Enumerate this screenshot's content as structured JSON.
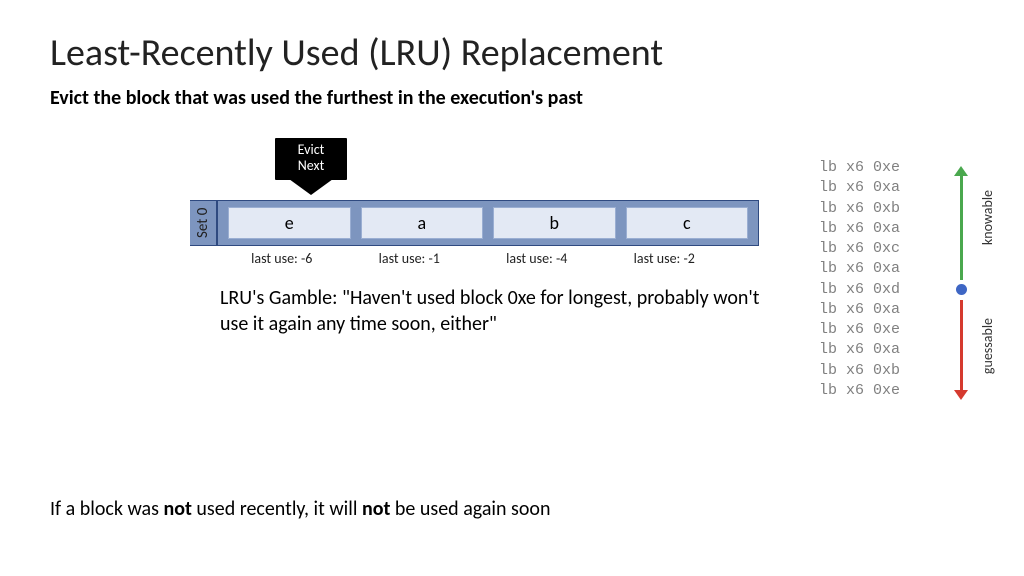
{
  "title": "Least-Recently Used (LRU) Replacement",
  "subtitle": "Evict the block that was used the furthest in the execution's past",
  "evict": {
    "line1": "Evict",
    "line2": "Next"
  },
  "set_label": "Set 0",
  "ways": [
    "e",
    "a",
    "b",
    "c"
  ],
  "last_use": [
    "last use: -6",
    "last use: -1",
    "last use: -4",
    "last use: -2"
  ],
  "gamble": "LRU's Gamble: \"Haven't used block 0xe for longest, probably won't use it again any time soon, either\"",
  "trace": [
    "lb x6 0xe",
    "lb x6 0xa",
    "lb x6 0xb",
    "lb x6 0xa",
    "lb x6 0xc",
    "lb x6 0xa",
    "lb x6 0xd",
    "lb x6 0xa",
    "lb x6 0xe",
    "lb x6 0xa",
    "lb x6 0xb",
    "lb x6 0xe"
  ],
  "rail": {
    "knowable": "knowable",
    "guessable": "guessable"
  },
  "bottom_pre": "If a block was ",
  "bottom_b1": "not",
  "bottom_mid": " used recently, it will ",
  "bottom_b2": "not",
  "bottom_post": " be used again soon"
}
